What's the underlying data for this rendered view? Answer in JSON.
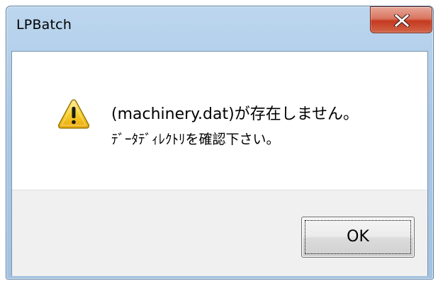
{
  "window": {
    "title": "LPBatch"
  },
  "message": {
    "line1": "(machinery.dat)が存在しません。",
    "line2": "ﾃﾞｰﾀﾃﾞｨﾚｸﾄﾘを確認下さい。",
    "icon": "warning-icon"
  },
  "buttons": {
    "ok_label": "OK",
    "close_icon": "close-icon"
  },
  "colors": {
    "close_button": "#c5391f",
    "warning_yellow": "#f5c518",
    "footer_bg": "#f0f0f0"
  }
}
